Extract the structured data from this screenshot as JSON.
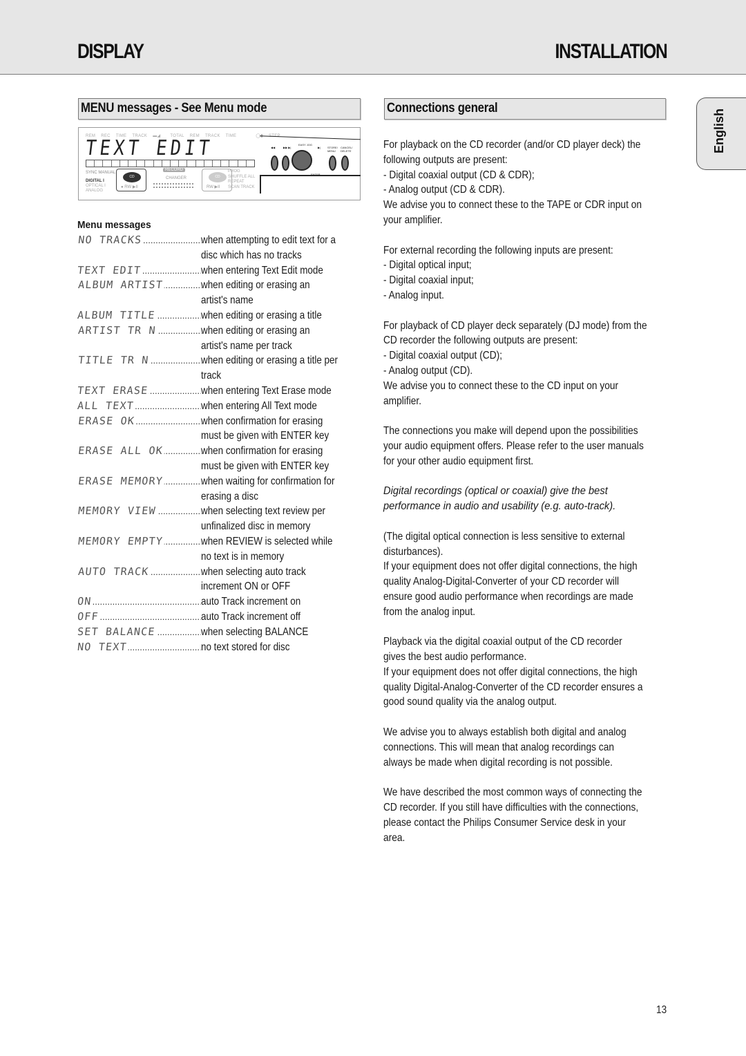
{
  "header": {
    "left_title": "DISPLAY",
    "right_title": "INSTALLATION"
  },
  "left_section": {
    "title": "MENU messages - See Menu mode",
    "display_figure": {
      "segment_text": "TEXT EDIT",
      "top_labels": [
        "REM",
        "REC",
        "TIME",
        "TRACK",
        "TOTAL",
        "REM",
        "TRACK",
        "TIME"
      ],
      "right_top_labels": [
        "STEP"
      ],
      "sync_label": "SYNC MANUAL",
      "inputs": [
        "DIGITAL I",
        "OPTICAL I",
        "ANALOG"
      ],
      "cd_label": "CD",
      "cd_controls": "● RW ▶II",
      "cd_controls_b": "RW ▶II",
      "record_label": "RECORD",
      "changer_label": "CHANGER",
      "prog_labels": [
        "PROG",
        "SHUFFLE  ALL",
        "REPEAT",
        "SCAN  TRACK"
      ],
      "panel_labels": [
        "◀◀",
        "▶▶ ▶|",
        "EASY JOG",
        "▶|",
        "STORE/ MENU",
        "CANCEL/ DELETE",
        "ENTER"
      ]
    },
    "subheading": "Menu messages",
    "messages": [
      {
        "code": "NO TRACKS",
        "desc": "when attempting to edit text for a disc which has no tracks"
      },
      {
        "code": "TEXT EDIT",
        "desc": "when entering Text Edit mode"
      },
      {
        "code": "ALBUM ARTIST",
        "desc": "when editing or erasing an artist's name"
      },
      {
        "code": "ALBUM TITLE",
        "desc": "when editing or erasing a title"
      },
      {
        "code": "ARTIST TR N",
        "desc": "when editing or erasing an artist's name per track"
      },
      {
        "code": "TITLE TR N",
        "desc": "when editing or erasing a title per track"
      },
      {
        "code": "TEXT ERASE",
        "desc": "when entering Text Erase mode"
      },
      {
        "code": "ALL TEXT",
        "desc": "when entering All Text mode"
      },
      {
        "code": "ERASE OK",
        "desc": "when confirmation for erasing must be given with ENTER key"
      },
      {
        "code": "ERASE ALL OK",
        "desc": "when confirmation for erasing must be given with ENTER key"
      },
      {
        "code": "ERASE MEMORY",
        "desc": "when waiting for confirmation for erasing a disc"
      },
      {
        "code": "MEMORY VIEW",
        "desc": "when selecting text review per unfinalized disc in memory"
      },
      {
        "code": "MEMORY EMPTY",
        "desc": "when REVIEW is selected while no text is in memory"
      },
      {
        "code": "AUTO TRACK",
        "desc": "when selecting auto track increment ON or OFF"
      },
      {
        "code": "ON",
        "desc": "auto Track increment on"
      },
      {
        "code": "OFF",
        "desc": "auto Track increment off"
      },
      {
        "code": "SET BALANCE",
        "desc": "when selecting BALANCE"
      },
      {
        "code": "NO TEXT",
        "desc": "no text stored for disc"
      }
    ]
  },
  "right_section": {
    "title": "Connections general",
    "paragraphs": [
      {
        "style": "normal",
        "lines": [
          "For playback on the CD recorder (and/or CD player deck) the",
          "following outputs are present:",
          "- Digital coaxial output (CD & CDR);",
          "- Analog output (CD & CDR).",
          "We advise you to connect these to the TAPE or CDR input on",
          "your amplifier."
        ]
      },
      {
        "style": "normal",
        "lines": [
          "For external recording the following inputs are present:",
          "- Digital optical input;",
          "- Digital coaxial input;",
          "- Analog input."
        ]
      },
      {
        "style": "normal",
        "lines": [
          "For playback of CD player deck separately (DJ mode) from the",
          "CD recorder the following outputs are present:",
          "- Digital coaxial output (CD);",
          "- Analog output (CD).",
          "We advise you to connect these to the CD input on your",
          "amplifier."
        ]
      },
      {
        "style": "normal",
        "lines": [
          "The connections you make will depend upon the possibilities",
          "your audio equipment offers. Please refer to the user manuals",
          "for your other audio equipment first."
        ]
      },
      {
        "style": "italic",
        "lines": [
          "Digital recordings (optical or coaxial) give the best",
          "performance in audio and usability (e.g. auto-track)."
        ]
      },
      {
        "style": "normal",
        "lines": [
          "(The digital optical connection is less sensitive to external",
          "disturbances).",
          "If your equipment does not offer digital connections, the high",
          "quality Analog-Digital-Converter of your CD recorder will",
          "ensure good audio performance when recordings are made",
          "from the analog input."
        ]
      },
      {
        "style": "normal",
        "lines": [
          "Playback via the digital coaxial output of the CD recorder",
          "gives the best audio performance.",
          "If your equipment does not offer digital connections, the high",
          "quality Digital-Analog-Converter of the CD recorder ensures a",
          "good sound quality via the analog output."
        ]
      },
      {
        "style": "normal",
        "lines": [
          "We advise you to always establish both digital and analog",
          "connections. This will mean that analog recordings can",
          "always be made when digital recording is not possible."
        ]
      },
      {
        "style": "normal",
        "lines": [
          "We have described the most common ways of connecting the",
          "CD recorder. If you still have difficulties with the connections,",
          "please contact the Philips Consumer Service desk in your",
          "area."
        ]
      }
    ]
  },
  "language_tab": "English",
  "page_number": "13"
}
